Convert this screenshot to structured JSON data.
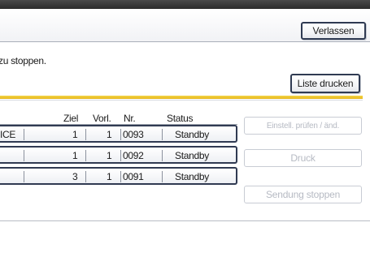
{
  "header": {
    "exit_label": "Verlassen"
  },
  "message": "zu stoppen.",
  "print_list_label": "Liste drucken",
  "columns": {
    "dest": "Ziel",
    "prev": "Vorl.",
    "nr": "Nr.",
    "status": "Status"
  },
  "rows": [
    {
      "name": "ICE",
      "dest": "1",
      "prev": "1",
      "nr": "0093",
      "status": "Standby"
    },
    {
      "name": "",
      "dest": "1",
      "prev": "1",
      "nr": "0092",
      "status": "Standby"
    },
    {
      "name": "",
      "dest": "3",
      "prev": "1",
      "nr": "0091",
      "status": "Standby"
    }
  ],
  "side_buttons": {
    "settings_label": "Einstell. prüfen / änd.",
    "print_label": "Druck",
    "stop_label": "Sendung stoppen"
  }
}
